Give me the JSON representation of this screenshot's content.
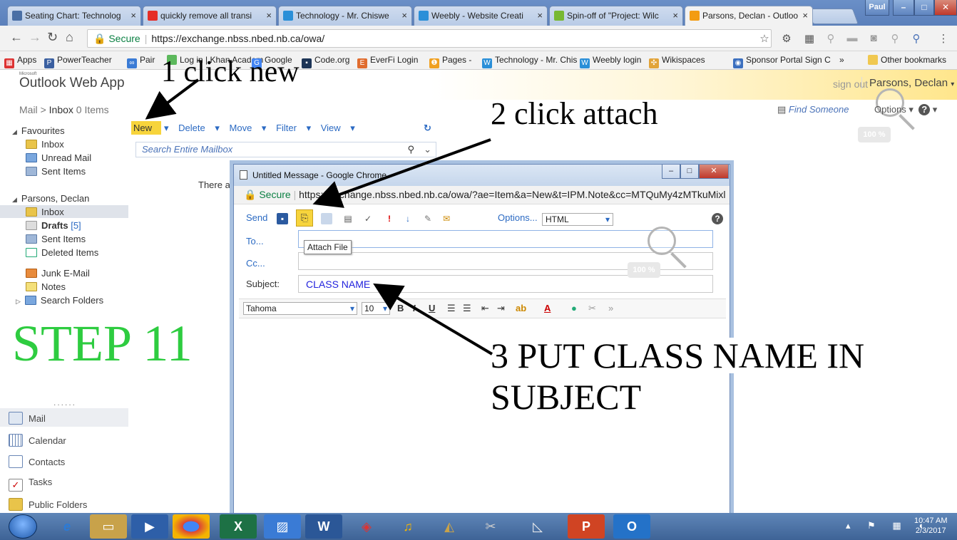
{
  "browser": {
    "tabs": [
      {
        "label": "Seating Chart: Technolog",
        "color": "#4a6fa5"
      },
      {
        "label": "quickly remove all transi",
        "color": "#e52d27"
      },
      {
        "label": "Technology - Mr. Chiswe",
        "color": "#2a8fd8"
      },
      {
        "label": "Weebly - Website Creati",
        "color": "#2a8fd8"
      },
      {
        "label": "Spin-off of \"Project: Wilc",
        "color": "#78b832"
      },
      {
        "label": "Parsons, Declan - Outloo",
        "color": "#f39c12"
      }
    ],
    "window_user": "Paul",
    "url_secure": "Secure",
    "url": "https://exchange.nbss.nbed.nb.ca/owa/",
    "bookmarks": [
      {
        "label": "Apps",
        "color": "#d33"
      },
      {
        "label": "PowerTeacher",
        "color": "#3a5fa0"
      },
      {
        "label": "Pair",
        "color": "#3a7bd5"
      },
      {
        "label": "Log in | Khan Academ",
        "color": "#5cb85c"
      },
      {
        "label": "Google",
        "color": "#4285f4"
      },
      {
        "label": "Code.org",
        "color": "#1d3557"
      },
      {
        "label": "EverFi Login",
        "color": "#e06c2e"
      },
      {
        "label": "Pages -",
        "color": "#f0a020"
      },
      {
        "label": "Technology - Mr. Chis",
        "color": "#2a8fd8"
      },
      {
        "label": "Weebly login",
        "color": "#2a8fd8"
      },
      {
        "label": "Wikispaces",
        "color": "#e2a43a"
      },
      {
        "label": "Sponsor Portal Sign C",
        "color": "#3b6fbf"
      },
      {
        "label": "»",
        "color": ""
      },
      {
        "label": "Other bookmarks",
        "color": "#f0c850"
      }
    ]
  },
  "owa": {
    "logo_small": "Microsoft",
    "logo": "Outlook Web App",
    "sign_out": "sign out",
    "user": "Parsons, Declan",
    "breadcrumb_mail": "Mail",
    "breadcrumb_sep": ">",
    "breadcrumb_inbox": "Inbox",
    "breadcrumb_count": "0 Items",
    "find_someone": "Find Someone",
    "options": "Options",
    "favourites": "Favourites",
    "fav_items": [
      "Inbox",
      "Unread Mail",
      "Sent Items"
    ],
    "account": "Parsons, Declan",
    "account_items": [
      "Inbox",
      "Drafts",
      "Sent Items",
      "Deleted Items",
      "Junk E-Mail",
      "Notes",
      "Search Folders"
    ],
    "drafts_count": "[5]",
    "toolbar": [
      "New",
      "Delete",
      "Move",
      "Filter",
      "View"
    ],
    "search_placeholder": "Search Entire Mailbox",
    "empty_text": "There ar",
    "nav_items": [
      "Mail",
      "Calendar",
      "Contacts",
      "Tasks",
      "Public Folders"
    ],
    "zoom": "100 %"
  },
  "popup": {
    "title": "Untitled Message - Google Chrome",
    "url_secure": "Secure",
    "url": "https://exchange.nbss.nbed.nb.ca/owa/?ae=Item&a=New&t=IPM.Note&cc=MTQuMy4zMTkuMixl",
    "send": "Send",
    "options": "Options...",
    "format": "HTML",
    "tooltip": "Attach File",
    "to_label": "To...",
    "cc_label": "Cc...",
    "subject_label": "Subject:",
    "subject_value": "CLASS NAME",
    "font": "Tahoma",
    "size": "10",
    "zoom": "100 %"
  },
  "annotations": {
    "step1": "1 click new",
    "step2": "2 click attach",
    "step3_line1": "3 PUT CLASS NAME IN",
    "step3_line2": "SUBJECT",
    "step": "STEP 11"
  },
  "taskbar": {
    "time": "10:47 AM",
    "date": "2/3/2017"
  }
}
